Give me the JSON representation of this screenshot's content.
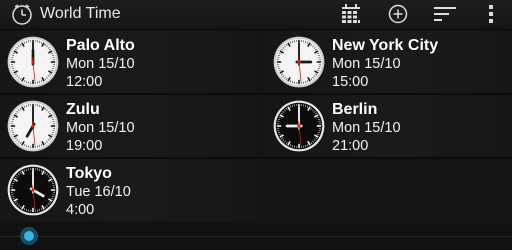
{
  "app": {
    "title": "World Time",
    "icon": "clock-icon"
  },
  "actions": [
    {
      "name": "calendar-grid-button",
      "icon": "calendar-grid-icon"
    },
    {
      "name": "add-button",
      "icon": "plus-circle-icon"
    },
    {
      "name": "sort-button",
      "icon": "sort-icon"
    },
    {
      "name": "overflow-menu-button",
      "icon": "more-vert-icon"
    }
  ],
  "clocks": [
    {
      "city": "Palo Alto",
      "date": "Mon 15/10",
      "time": "12:00",
      "face": "light",
      "h": 12,
      "m": 0,
      "s": 29
    },
    {
      "city": "New York City",
      "date": "Mon 15/10",
      "time": "15:00",
      "face": "light",
      "h": 15,
      "m": 0,
      "s": 29
    },
    {
      "city": "Zulu",
      "date": "Mon 15/10",
      "time": "19:00",
      "face": "light",
      "h": 19,
      "m": 0,
      "s": 29
    },
    {
      "city": "Berlin",
      "date": "Mon 15/10",
      "time": "21:00",
      "face": "dark",
      "h": 21,
      "m": 0,
      "s": 29
    },
    {
      "city": "Tokyo",
      "date": "Tue 16/10",
      "time": "4:00",
      "face": "dark",
      "h": 4,
      "m": 0,
      "s": 29
    }
  ],
  "colors": {
    "accent": "#33b5e5",
    "second_hand": "#d02020"
  }
}
